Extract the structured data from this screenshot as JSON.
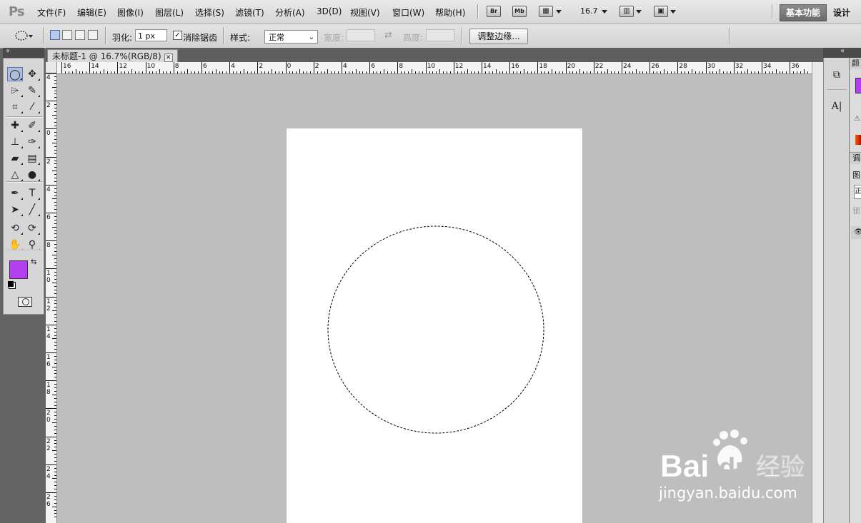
{
  "app": {
    "logo": "Ps"
  },
  "menu": {
    "items": [
      "文件(F)",
      "编辑(E)",
      "图像(I)",
      "图层(L)",
      "选择(S)",
      "滤镜(T)",
      "分析(A)",
      "3D(D)",
      "视图(V)",
      "窗口(W)",
      "帮助(H)"
    ],
    "bridge_label": "Br",
    "minibridge_label": "Mb",
    "zoom_value": "16.7",
    "workspace_active": "基本功能",
    "workspace_design": "设计"
  },
  "options": {
    "feather_label": "羽化:",
    "feather_value": "1 px",
    "antialias_label": "消除锯齿",
    "antialias_checked": true,
    "style_label": "样式:",
    "style_value": "正常",
    "width_label": "宽度:",
    "height_label": "高度:",
    "refine_edge_label": "调整边缘..."
  },
  "document": {
    "tab_title": "未标题-1 @ 16.7%(RGB/8)",
    "close_glyph": "✕",
    "hruler_labels": [
      "16",
      "14",
      "12",
      "10",
      "8",
      "6",
      "4",
      "2",
      "0",
      "2",
      "4",
      "6",
      "8",
      "10",
      "12",
      "14",
      "16",
      "18",
      "20",
      "22",
      "24",
      "26",
      "28",
      "30",
      "32",
      "34",
      "36"
    ],
    "vruler_labels": [
      "4",
      "2",
      "0",
      "2",
      "4",
      "6",
      "8",
      "10",
      "12",
      "14",
      "16",
      "18",
      "20",
      "22",
      "24",
      "26"
    ]
  },
  "colors": {
    "foreground": "#b43ff0",
    "background": "#ffffff",
    "canvas_bg": "#bebebe",
    "active_workspace": "#7a7a7a"
  },
  "tools": [
    [
      "elliptical-marquee-icon",
      "move-icon"
    ],
    [
      "polygonal-lasso-icon",
      "quick-selection-icon"
    ],
    [
      "crop-icon",
      "eyedropper-icon"
    ],
    [
      "spot-healing-icon",
      "brush-icon"
    ],
    [
      "clone-stamp-icon",
      "history-brush-icon"
    ],
    [
      "eraser-icon",
      "gradient-icon"
    ],
    [
      "blur-icon",
      "dodge-icon"
    ],
    [
      "pen-icon",
      "type-icon"
    ],
    [
      "path-selection-icon",
      "line-icon"
    ],
    [
      "3d-rotate-icon",
      "3d-orbit-icon"
    ],
    [
      "hand-icon",
      "zoom-icon"
    ]
  ],
  "watermark": {
    "brand": "Bai",
    "brand2": "经验",
    "url": "jingyan.baidu.com"
  }
}
